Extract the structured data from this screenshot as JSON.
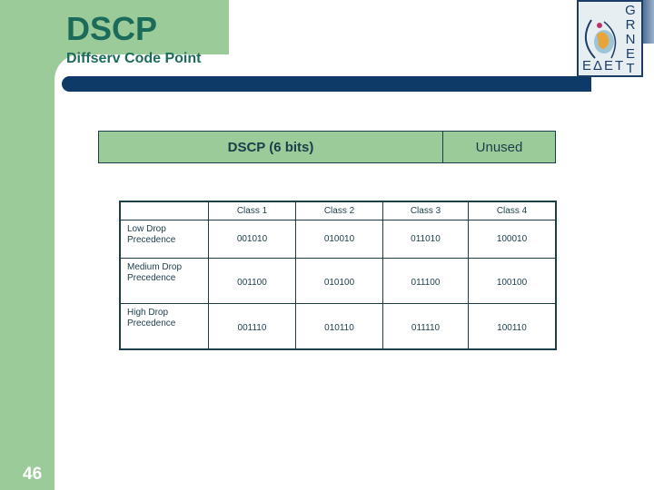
{
  "slide": {
    "title": "DSCP",
    "subtitle": "Diffserv Code Point",
    "number": "46"
  },
  "logo": {
    "letters_vertical": [
      "G",
      "R",
      "N",
      "E",
      "T"
    ],
    "letters_bottom": "ΕΔΕΤ"
  },
  "dscp_field": {
    "bits_label": "DSCP (6 bits)",
    "unused_label": "Unused"
  },
  "table": {
    "columns": [
      "Class 1",
      "Class 2",
      "Class 3",
      "Class 4"
    ],
    "rows": [
      {
        "label": [
          "Low Drop",
          "Precedence"
        ],
        "values": [
          "001010",
          "010010",
          "011010",
          "100010"
        ]
      },
      {
        "label": [
          "Medium Drop",
          "Precedence"
        ],
        "values": [
          "001100",
          "010100",
          "011100",
          "100100"
        ]
      },
      {
        "label": [
          "High Drop",
          "Precedence"
        ],
        "values": [
          "001110",
          "010110",
          "011110",
          "100110"
        ]
      }
    ]
  },
  "colors": {
    "accent_green": "#9ccb9a",
    "title_text": "#1b6b5a",
    "bar_navy": "#0d3a66"
  }
}
